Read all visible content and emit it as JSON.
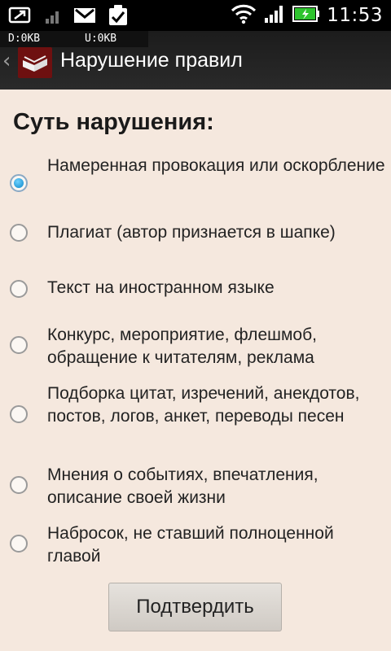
{
  "status_bar": {
    "time": "11:53",
    "icons": [
      "screen-share-icon",
      "signal-weak-icon",
      "gmail-icon",
      "task-check-icon",
      "wifi-icon",
      "cell-signal-icon",
      "battery-charging-icon"
    ],
    "download_label": "D:0KB",
    "upload_label": "U:0KB"
  },
  "action_bar": {
    "title": "Нарушение правил",
    "back_icon": "chevron-left-icon",
    "app_icon": "book-icon"
  },
  "form": {
    "heading": "Суть нарушения:",
    "options": [
      {
        "label": "Намеренная провокация или оскорбление",
        "checked": true
      },
      {
        "label": "Плагиат (автор признается в шапке)",
        "checked": false
      },
      {
        "label": "Текст на иностранном языке",
        "checked": false
      },
      {
        "label": "Конкурс, мероприятие, флешмоб, обращение к читателям, реклама",
        "checked": false
      },
      {
        "label": "Подборка цитат, изречений, анекдотов, постов, логов, анкет, переводы песен",
        "checked": false
      },
      {
        "label": "Мнения о событиях, впечатления, описание своей жизни",
        "checked": false
      },
      {
        "label": "Набросок, не ставший полноценной главой",
        "checked": false
      }
    ],
    "confirm_label": "Подтвердить"
  }
}
